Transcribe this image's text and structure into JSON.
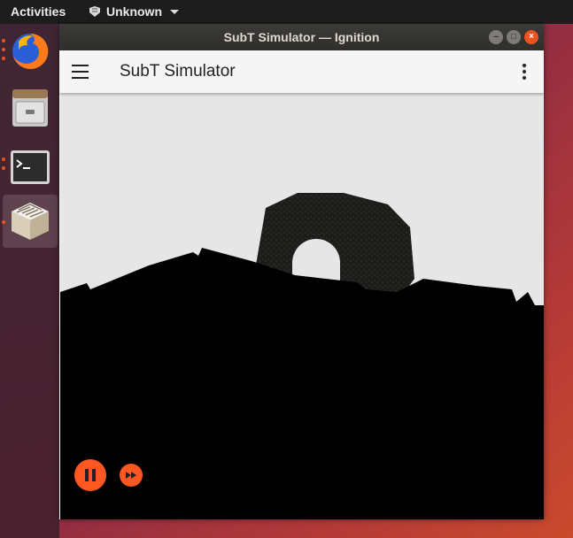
{
  "topbar": {
    "activities": "Activities",
    "app_name": "Unknown"
  },
  "dock": {
    "items": [
      {
        "name": "firefox",
        "running": true
      },
      {
        "name": "files",
        "running": false
      },
      {
        "name": "terminal",
        "running": true
      },
      {
        "name": "subt-simulator",
        "running": true,
        "active": true
      }
    ]
  },
  "window": {
    "title": "SubT Simulator — Ignition",
    "buttons": [
      "minimize",
      "maximize",
      "close"
    ]
  },
  "appbar": {
    "title": "SubT Simulator"
  },
  "playback": {
    "state": "playing",
    "pause_label": "pause",
    "step_label": "fast-forward"
  },
  "colors": {
    "accent": "#ff5722",
    "ubuntu_orange": "#e95420"
  }
}
